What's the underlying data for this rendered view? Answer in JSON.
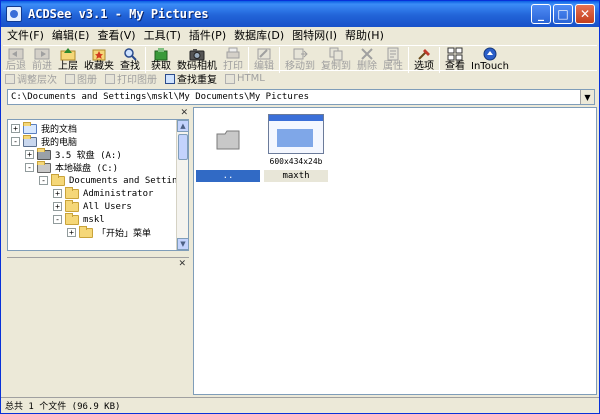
{
  "window": {
    "title": "ACDSee v3.1 - My Pictures"
  },
  "menu": [
    "文件(F)",
    "编辑(E)",
    "查看(V)",
    "工具(T)",
    "插件(P)",
    "数据库(D)",
    "图特网(I)",
    "帮助(H)"
  ],
  "toolbar": [
    {
      "label": "后退",
      "icon": "back-icon",
      "enabled": false
    },
    {
      "label": "前进",
      "icon": "forward-icon",
      "enabled": false
    },
    {
      "label": "上层",
      "icon": "up-folder-icon",
      "enabled": true
    },
    {
      "label": "收藏夹",
      "icon": "favorites-icon",
      "enabled": true
    },
    {
      "label": "查找",
      "icon": "find-icon",
      "enabled": true
    },
    {
      "label": "获取",
      "icon": "acquire-icon",
      "enabled": true
    },
    {
      "label": "数码相机",
      "icon": "camera-icon",
      "enabled": true
    },
    {
      "label": "打印",
      "icon": "print-icon",
      "enabled": false
    },
    {
      "label": "编辑",
      "icon": "edit-icon",
      "enabled": false
    },
    {
      "label": "移动到",
      "icon": "move-icon",
      "enabled": false
    },
    {
      "label": "复制到",
      "icon": "copy-icon",
      "enabled": false
    },
    {
      "label": "删除",
      "icon": "delete-icon",
      "enabled": false
    },
    {
      "label": "属性",
      "icon": "properties-icon",
      "enabled": false
    },
    {
      "label": "选项",
      "icon": "options-icon",
      "enabled": true
    },
    {
      "label": "查看",
      "icon": "view-icon",
      "enabled": true
    },
    {
      "label": "InTouch",
      "icon": "intouch-icon",
      "enabled": true
    }
  ],
  "toolbar2": [
    {
      "label": "调整层次",
      "enabled": false
    },
    {
      "label": "图册",
      "enabled": false
    },
    {
      "label": "打印图册",
      "enabled": false
    },
    {
      "label": "查找重复",
      "enabled": true
    },
    {
      "label": "HTML",
      "enabled": false
    }
  ],
  "path": "C:\\Documents and Settings\\mskl\\My Documents\\My Pictures",
  "tree": [
    {
      "label": "我的文档",
      "expander": "+",
      "level": 0
    },
    {
      "label": "我的电脑",
      "expander": "-",
      "level": 0
    },
    {
      "label": "3.5 软盘 (A:)",
      "expander": "+",
      "level": 1
    },
    {
      "label": "本地磁盘 (C:)",
      "expander": "-",
      "level": 1
    },
    {
      "label": "Documents and Settings",
      "expander": "-",
      "level": 2
    },
    {
      "label": "Administrator",
      "expander": "+",
      "level": 3
    },
    {
      "label": "All Users",
      "expander": "+",
      "level": 3
    },
    {
      "label": "mskl",
      "expander": "-",
      "level": 3
    },
    {
      "label": "「开始」菜单",
      "expander": "+",
      "level": 4
    }
  ],
  "files": [
    {
      "label": "..",
      "type": "parent-folder",
      "selected": true
    },
    {
      "label": "maxth",
      "type": "image",
      "caption": "600x434x24b",
      "selected": false
    }
  ],
  "status": "总共 1 个文件 (96.9 KB)"
}
